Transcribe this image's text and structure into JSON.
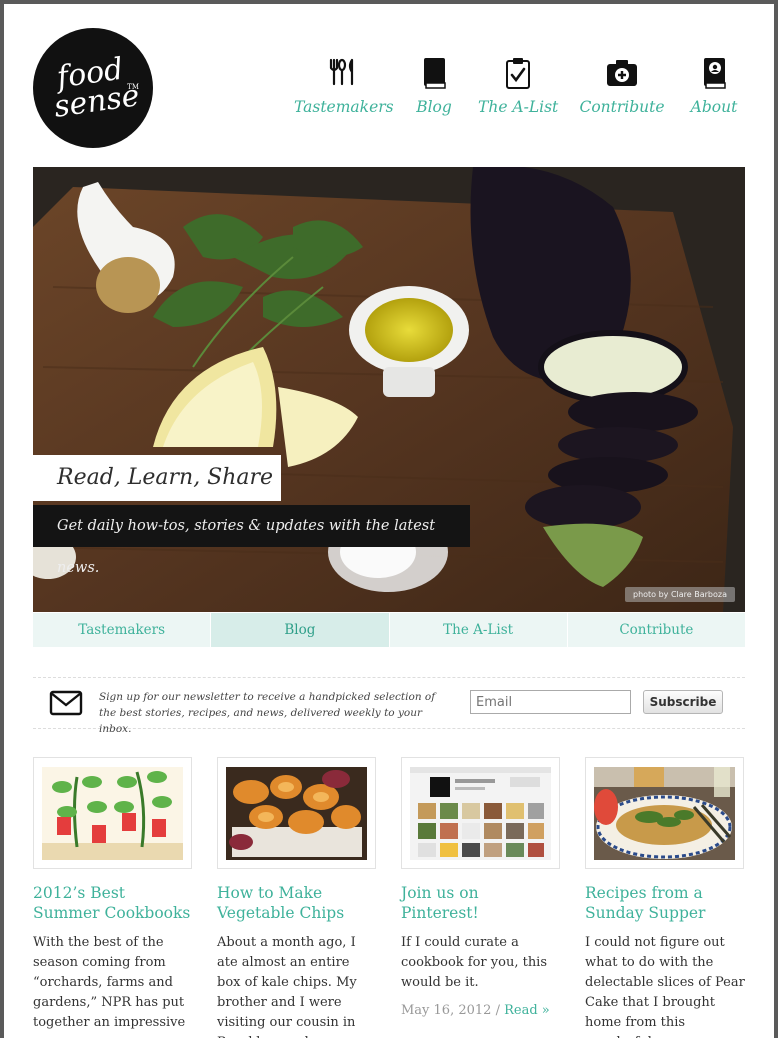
{
  "brand": {
    "logo_line1": "food",
    "logo_line2": "sense",
    "logo_tm": "TM"
  },
  "nav": [
    {
      "label": "Tastemakers",
      "icon": "utensils-icon"
    },
    {
      "label": "Blog",
      "icon": "book-icon"
    },
    {
      "label": "The A-List",
      "icon": "clipboard-check-icon"
    },
    {
      "label": "Contribute",
      "icon": "camera-plus-icon"
    },
    {
      "label": "About",
      "icon": "profile-book-icon"
    }
  ],
  "hero": {
    "title": "Read, Learn, Share",
    "subtitle": "Get daily how-tos, stories & updates with the latest news.",
    "photo_credit": "photo by Clare Barboza"
  },
  "tabs": [
    {
      "label": "Tastemakers"
    },
    {
      "label": "Blog"
    },
    {
      "label": "The A-List"
    },
    {
      "label": "Contribute"
    }
  ],
  "newsletter": {
    "text": "Sign up for our newsletter to receive a handpicked selection of the best stories, recipes, and news, delivered weekly to your inbox.",
    "email_placeholder": "Email",
    "button_label": "Subscribe"
  },
  "posts": [
    {
      "title": "2012’s Best Summer Cookbooks",
      "excerpt": "With the best of the season coming from “orchards, farms and gardens,” NPR has put together an impressive"
    },
    {
      "title": "How to Make Vegetable Chips",
      "excerpt": "About a month ago, I ate almost an entire box of kale chips. My brother and I were visiting our cousin in Brooklyn, and"
    },
    {
      "title": "Join us on Pinterest!",
      "excerpt": "If I could curate a cookbook for you, this would be it.",
      "date": "May 16, 2012",
      "separator": "/",
      "read_more": "Read »"
    },
    {
      "title": "Recipes from a Sunday Supper",
      "excerpt": "I could not figure out what to do with the delectable slices of Pear Cake that I brought home from this wonderful"
    }
  ],
  "colors": {
    "accent": "#3fb29b",
    "tab_bg": "#ecf6f4",
    "tab_active_bg": "#d7ede9"
  }
}
